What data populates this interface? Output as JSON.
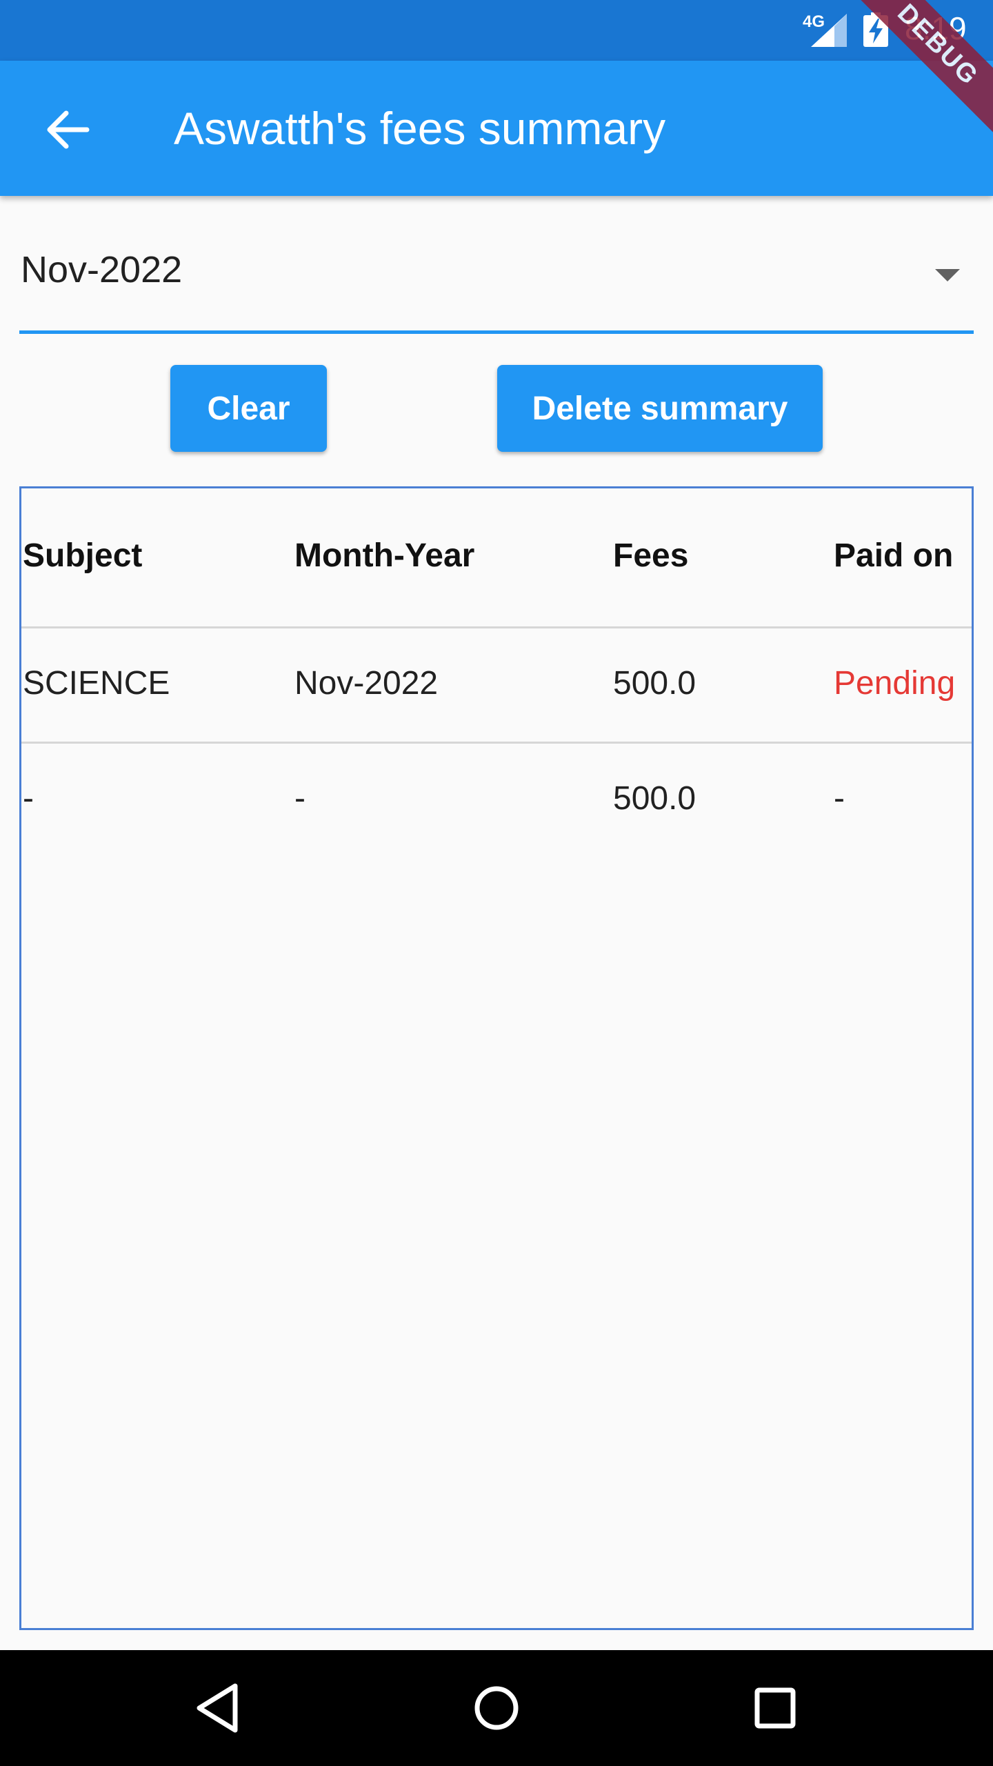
{
  "status_bar": {
    "network": "4G",
    "time": "8:19"
  },
  "debug_banner": "DEBUG",
  "app_bar": {
    "title": "Aswatth's fees summary"
  },
  "month_select": {
    "selected": "Nov-2022"
  },
  "buttons": {
    "clear": "Clear",
    "delete_summary": "Delete summary"
  },
  "table": {
    "headers": [
      "Subject",
      "Month-Year",
      "Fees",
      "Paid on"
    ],
    "rows": [
      [
        "SCIENCE",
        "Nov-2022",
        "500.0",
        "Pending"
      ],
      [
        "-",
        "-",
        "500.0",
        "-"
      ]
    ]
  },
  "colors": {
    "app_bar": "#2196f3",
    "status_bar": "#1976d2",
    "pending": "#e53935"
  },
  "icons": {
    "back": "arrow-left-icon",
    "dropdown": "triangle-down-icon",
    "nav_back": "triangle-back-icon",
    "nav_home": "circle-home-icon",
    "nav_recents": "square-recents-icon"
  }
}
